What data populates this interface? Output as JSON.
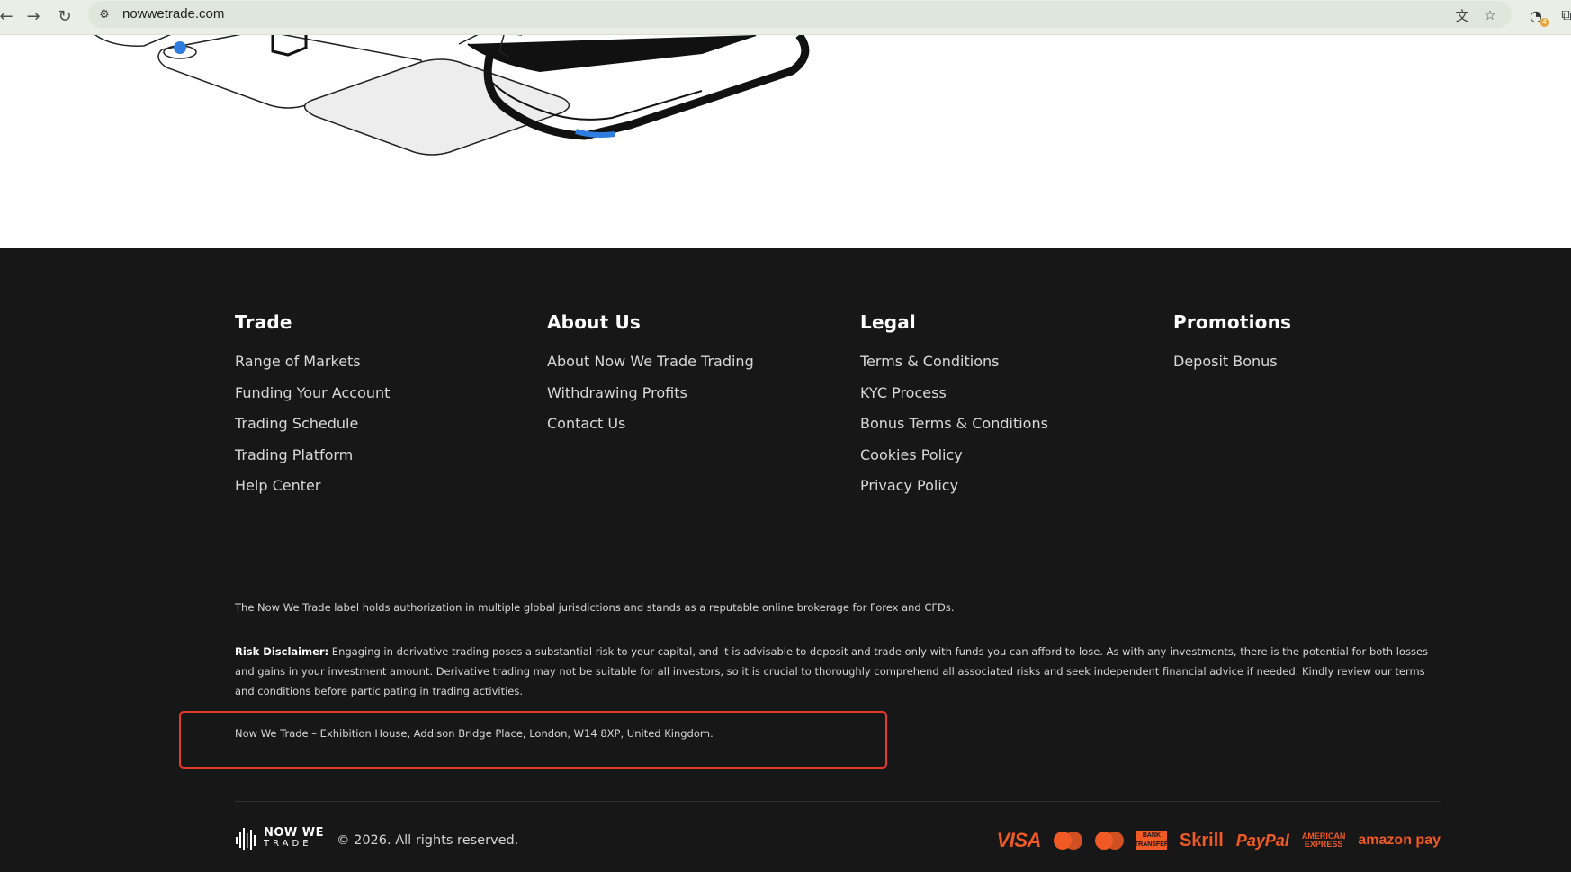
{
  "browser": {
    "url": "nowwetrade.com",
    "icons": [
      "back-icon",
      "forward-icon",
      "reload-icon",
      "site-info-icon",
      "translate-icon",
      "bookmark-star-icon",
      "extension-icon",
      "extensions-puzzle-icon"
    ],
    "extension_badge": "4"
  },
  "footer": {
    "columns": [
      {
        "heading": "Trade",
        "links": [
          "Range of Markets",
          "Funding Your Account",
          "Trading Schedule",
          "Trading Platform",
          "Help Center"
        ]
      },
      {
        "heading": "About Us",
        "links": [
          "About Now We Trade Trading",
          "Withdrawing Profits",
          "Contact Us"
        ]
      },
      {
        "heading": "Legal",
        "links": [
          "Terms & Conditions",
          "KYC Process",
          "Bonus Terms & Conditions",
          "Cookies Policy",
          "Privacy Policy"
        ]
      },
      {
        "heading": "Promotions",
        "links": [
          "Deposit Bonus"
        ]
      }
    ],
    "authorization_text": "The Now We Trade label holds authorization in multiple global jurisdictions and stands as a reputable online brokerage for Forex and CFDs.",
    "risk_label": "Risk Disclaimer:",
    "risk_text": "Engaging in derivative trading poses a substantial risk to your capital, and it is advisable to deposit and trade only with funds you can afford to lose. As with any investments, there is the potential for both losses and gains in your investment amount. Derivative trading may not be suitable for all investors, so it is crucial to thoroughly comprehend all associated risks and seek independent financial advice if needed. Kindly review our terms and conditions before participating in trading activities.",
    "address": "Now We Trade – Exhibition House, Addison Bridge Place, London, W14 8XP, United Kingdom.",
    "brand_line1": "NOW WE",
    "brand_line2": "TRADE",
    "copyright": "© 2026. All rights reserved.",
    "payments": {
      "visa": "VISA",
      "mastercard": "MasterCard",
      "maestro": "Maestro",
      "bank_line1": "BANK",
      "bank_line2": "TRANSFER",
      "skrill": "Skrill",
      "paypal": "PayPal",
      "amex_line1": "AMERICAN",
      "amex_line2": "EXPRESS",
      "amazon": "amazon pay"
    },
    "accent_color": "#f15a24",
    "highlight_color": "#e53b2a",
    "background_color": "#171717"
  }
}
